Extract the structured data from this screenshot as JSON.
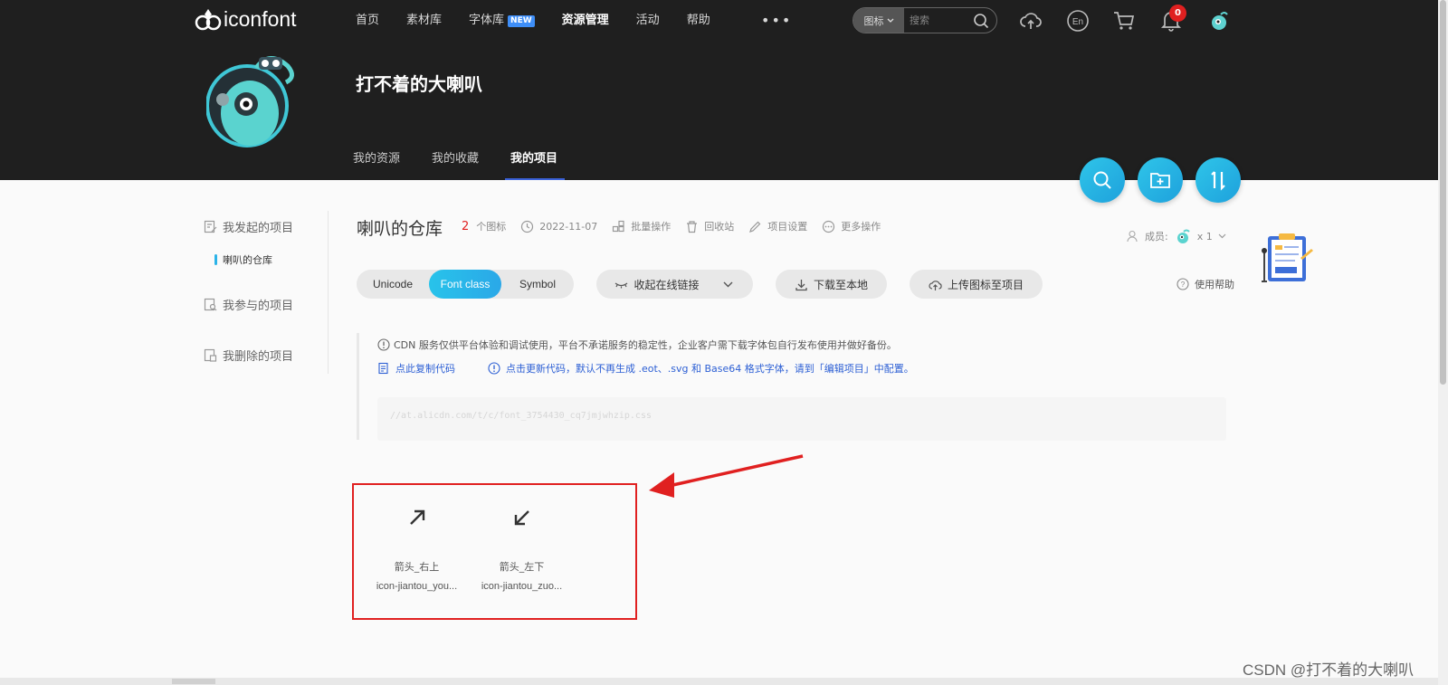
{
  "header": {
    "logo_text": "iconfont",
    "nav": [
      {
        "label": "首页",
        "active": false
      },
      {
        "label": "素材库",
        "active": false
      },
      {
        "label": "字体库",
        "active": false,
        "badge": "NEW"
      },
      {
        "label": "资源管理",
        "active": true
      },
      {
        "label": "活动",
        "active": false
      },
      {
        "label": "帮助",
        "active": false
      }
    ],
    "more": "•••",
    "search_type": "图标",
    "search_placeholder": "搜索",
    "notification_count": "0"
  },
  "profile": {
    "name": "打不着的大喇叭",
    "tabs": [
      {
        "label": "我的资源",
        "active": false
      },
      {
        "label": "我的收藏",
        "active": false
      },
      {
        "label": "我的项目",
        "active": true
      }
    ]
  },
  "sidebar": {
    "started": "我发起的项目",
    "started_sub": "喇叭的仓库",
    "joined": "我参与的项目",
    "deleted": "我删除的项目"
  },
  "project": {
    "title": "喇叭的仓库",
    "icon_count": "2",
    "icon_count_label": "个图标",
    "date": "2022-11-07",
    "batch": "批量操作",
    "trash": "回收站",
    "settings": "项目设置",
    "more": "更多操作",
    "members_label": "成员:",
    "members_count": "x 1",
    "help": "使用帮助"
  },
  "toolbar": {
    "modes": [
      {
        "label": "Unicode",
        "active": false
      },
      {
        "label": "Font class",
        "active": true
      },
      {
        "label": "Symbol",
        "active": false
      }
    ],
    "collapse_link": "收起在线链接",
    "download": "下载至本地",
    "upload": "上传图标至项目"
  },
  "notice": {
    "line1": "CDN 服务仅供平台体验和调试使用，平台不承诺服务的稳定性，企业客户需下载字体包自行发布使用并做好备份。",
    "copy_code": "点此复制代码",
    "update_code": "点击更新代码，默认不再生成 .eot、.svg 和 Base64 格式字体，请到「编辑项目」中配置。",
    "cdn_url": "//at.alicdn.com/t/c/font_3754430_cq7jmjwhzip.css"
  },
  "icons": [
    {
      "name": "箭头_右上",
      "class": "icon-jiantou_you...",
      "glyph": "arrow-up-right-icon"
    },
    {
      "name": "箭头_左下",
      "class": "icon-jiantou_zuo...",
      "glyph": "arrow-down-left-icon"
    }
  ],
  "watermark": "CSDN @打不着的大喇叭",
  "colors": {
    "header_bg": "#1f1f1f",
    "accent": "#2bb3e8",
    "highlight_red": "#e02020",
    "link_blue": "#2c5fd4"
  }
}
